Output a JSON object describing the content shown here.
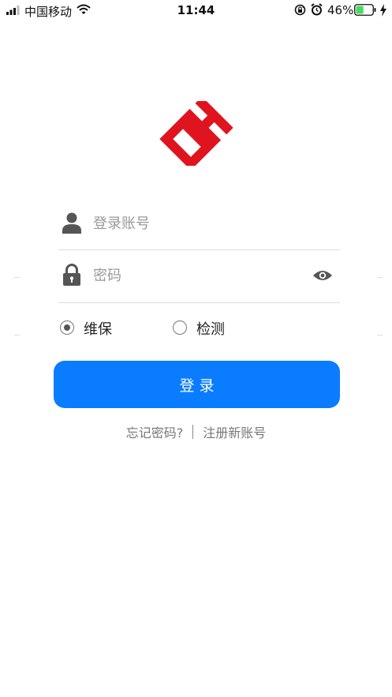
{
  "status_bar": {
    "carrier": "中国移动",
    "time": "11:44",
    "battery_percent": "46%",
    "battery_level": 0.46,
    "icons": [
      "signal-icon",
      "wifi-icon",
      "lock-rotation-icon",
      "alarm-icon",
      "battery-icon",
      "charging-icon"
    ]
  },
  "logo": {
    "icon": "brand-logo-icon",
    "color": "#e0141e"
  },
  "form": {
    "account": {
      "icon": "user-icon",
      "placeholder": "登录账号",
      "value": ""
    },
    "password": {
      "icon": "lock-icon",
      "placeholder": "密码",
      "value": "",
      "toggle_icon": "eye-icon"
    }
  },
  "role": {
    "options": [
      {
        "label": "维保",
        "checked": true
      },
      {
        "label": "检测",
        "checked": false
      }
    ]
  },
  "login_button": {
    "label": "登 录",
    "color": "#0a7cff"
  },
  "links": {
    "forgot_password": "忘记密码?",
    "register": "注册新账号"
  }
}
